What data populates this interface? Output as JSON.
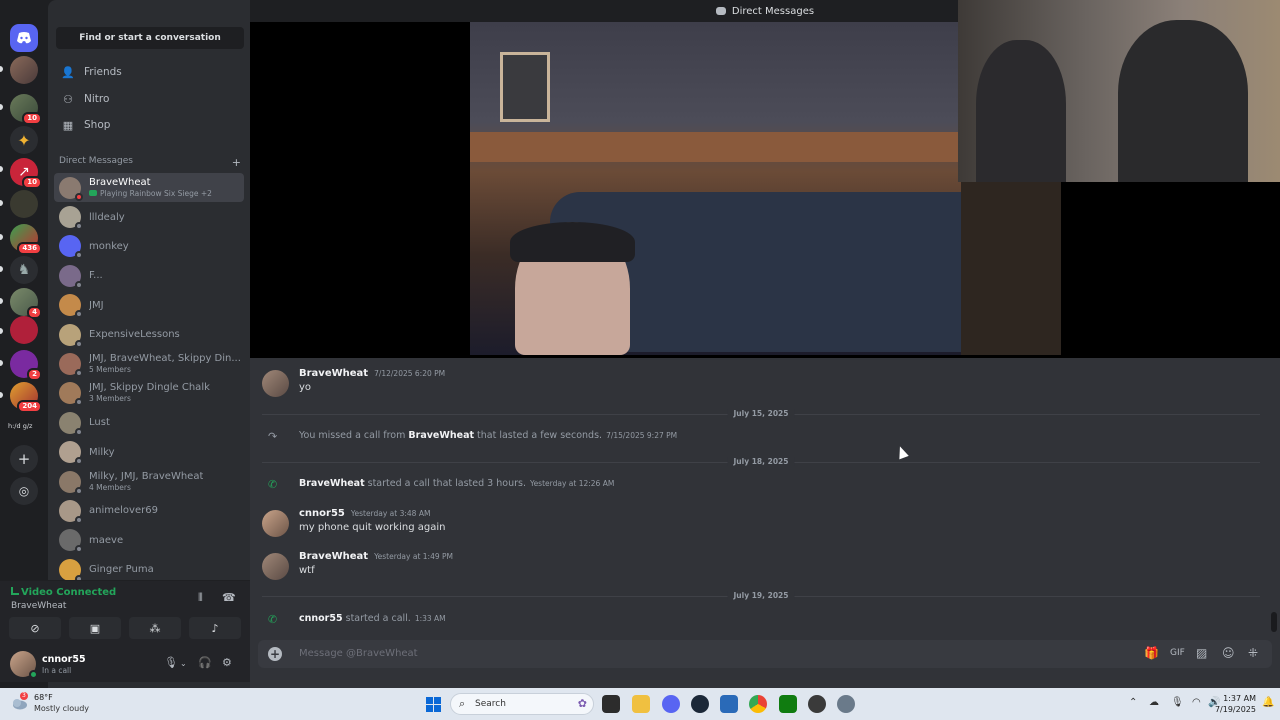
{
  "window": {
    "title": "Direct Messages"
  },
  "rail": {
    "servers": [
      {
        "icon": "discord-home-icon",
        "badge": ""
      },
      {
        "icon": "avatar",
        "badge": ""
      },
      {
        "icon": "avatar",
        "badge": "10"
      },
      {
        "icon": "star-icon",
        "badge": ""
      },
      {
        "icon": "arrow-icon",
        "badge": "10"
      },
      {
        "icon": "server-icon",
        "badge": ""
      },
      {
        "icon": "server-icon",
        "badge": "436"
      },
      {
        "icon": "server-icon",
        "badge": ""
      },
      {
        "icon": "server-icon",
        "badge": "4"
      },
      {
        "icon": "server-icon",
        "badge": ""
      },
      {
        "icon": "server-icon",
        "badge": "2"
      },
      {
        "icon": "server-icon",
        "badge": "204"
      },
      {
        "icon": "folder",
        "badge": ""
      }
    ],
    "folder_label": "h:/d g/z"
  },
  "sidebar": {
    "find_label": "Find or start a conversation",
    "nav": [
      {
        "label": "Friends",
        "icon": "friends-icon"
      },
      {
        "label": "Nitro",
        "icon": "nitro-icon"
      },
      {
        "label": "Shop",
        "icon": "shop-icon"
      }
    ],
    "dm_header": "Direct Messages",
    "dms": [
      {
        "name": "BraveWheat",
        "sub": "Playing Rainbow Six Siege +2",
        "active": true,
        "status": "dnd",
        "color": "#8a7a70"
      },
      {
        "name": "llldealy",
        "sub": "",
        "color": "#a8a294"
      },
      {
        "name": "monkey",
        "sub": "",
        "color": "#5865f2"
      },
      {
        "name": "F...",
        "sub": "",
        "color": "#7a6a8a"
      },
      {
        "name": "JMJ",
        "sub": "",
        "color": "#c48a4a"
      },
      {
        "name": "ExpensiveLessons",
        "sub": "",
        "color": "#b8a27a"
      },
      {
        "name": "JMJ, BraveWheat, Skippy Din...",
        "sub": "5 Members",
        "color": "#9a6a5a"
      },
      {
        "name": "JMJ, Skippy Dingle Chalk",
        "sub": "3 Members",
        "color": "#a07a5a"
      },
      {
        "name": "Lust",
        "sub": "",
        "color": "#8a8270"
      },
      {
        "name": "Milky",
        "sub": "",
        "color": "#b0a090"
      },
      {
        "name": "Milky, JMJ, BraveWheat",
        "sub": "4 Members",
        "color": "#8a7868"
      },
      {
        "name": "animelover69",
        "sub": "",
        "color": "#a89888"
      },
      {
        "name": "maeve",
        "sub": "",
        "color": "#6a6a6a"
      },
      {
        "name": "Ginger Puma",
        "sub": "",
        "color": "#d8a040"
      }
    ]
  },
  "voice": {
    "status": "Video Connected",
    "channel": "BraveWheat"
  },
  "user": {
    "name": "cnnor55",
    "status": "In a call"
  },
  "chat": {
    "messages": [
      {
        "author": "BraveWheat",
        "time": "7/12/2025 6:20 PM",
        "body": "yo"
      }
    ],
    "divider1": "July 15, 2025",
    "missed": {
      "pre": "You missed a call from ",
      "who": "BraveWheat",
      "post": " that lasted a few seconds.",
      "time": "7/15/2025 9:27 PM"
    },
    "divider2": "July 18, 2025",
    "call1": {
      "who": "BraveWheat",
      "post": " started a call that lasted 3 hours.",
      "time": "Yesterday at 12:26 AM"
    },
    "msg2": {
      "author": "cnnor55",
      "time": "Yesterday at 3:48 AM",
      "body": "my phone quit working again"
    },
    "msg3": {
      "author": "BraveWheat",
      "time": "Yesterday at 1:49 PM",
      "body": "wtf"
    },
    "divider3": "July 19, 2025",
    "call2": {
      "who": "cnnor55",
      "post": " started a call.",
      "time": "1:33 AM"
    }
  },
  "composer": {
    "placeholder": "Message @BraveWheat"
  },
  "taskbar": {
    "temp": "68°F",
    "condition": "Mostly cloudy",
    "weather_badge": "3",
    "search": "Search",
    "time": "1:37 AM",
    "date": "7/19/2025"
  },
  "colors": {
    "accent": "#5865f2",
    "green": "#23a55a",
    "red": "#f23f42"
  }
}
